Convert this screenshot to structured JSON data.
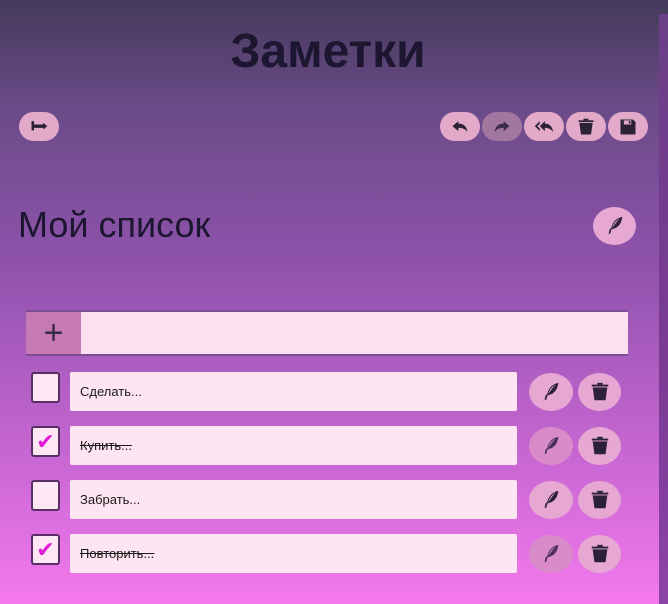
{
  "header": {
    "title": "Заметки"
  },
  "toolbar": {
    "back_icon": "return-icon",
    "undo_icon": "undo-icon",
    "redo_icon": "redo-icon",
    "reply_all_icon": "reply-all-icon",
    "delete_icon": "trash-icon",
    "save_icon": "floppy-icon"
  },
  "list": {
    "title": "Мой список",
    "edit_icon": "feather-icon",
    "new_item_placeholder": "",
    "add_symbol": "+",
    "items": [
      {
        "text": "Сделать...",
        "checked": false,
        "check_mark": ""
      },
      {
        "text": "Купить...",
        "checked": true,
        "check_mark": "✔"
      },
      {
        "text": "Забрать...",
        "checked": false,
        "check_mark": ""
      },
      {
        "text": "Повторить...",
        "checked": true,
        "check_mark": "✔"
      }
    ]
  },
  "colors": {
    "accent": "#e2a9c9",
    "check": "#e11bd6",
    "title": "#1c1630"
  }
}
